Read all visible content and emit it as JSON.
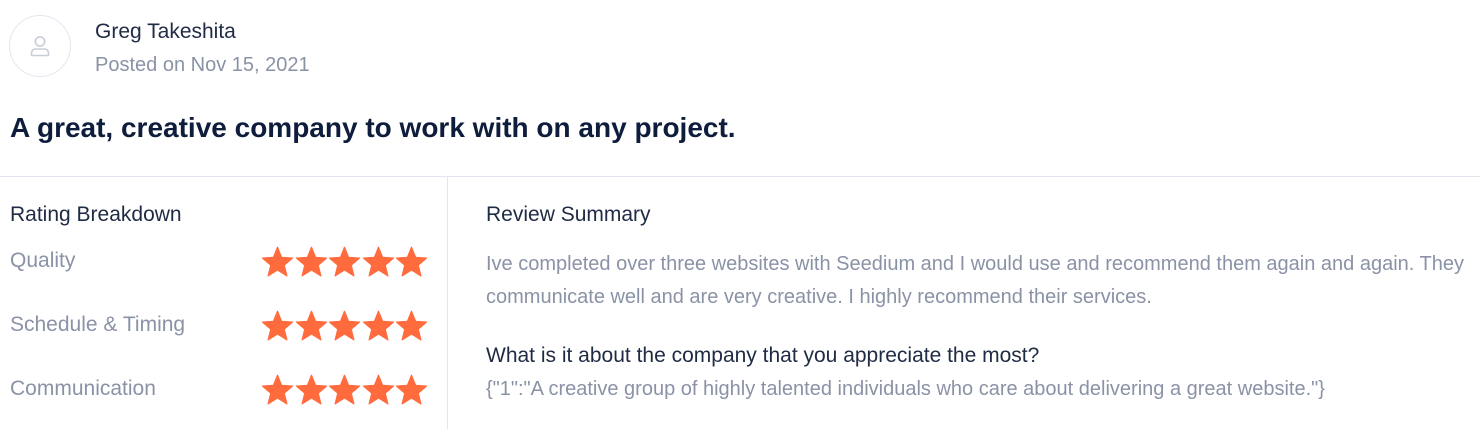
{
  "author": {
    "name": "Greg Takeshita",
    "posted": "Posted on Nov 15, 2021",
    "avatar_icon": "user-icon"
  },
  "headline": "A great, creative company to work with on any project.",
  "breakdown": {
    "title": "Rating Breakdown",
    "star_color": "#ff6b3d",
    "star_icon": "star-icon",
    "max_stars": 5,
    "items": [
      {
        "label": "Quality",
        "stars": 5
      },
      {
        "label": "Schedule & Timing",
        "stars": 5
      },
      {
        "label": "Communication",
        "stars": 5
      }
    ]
  },
  "summary": {
    "title": "Review Summary",
    "text": "Ive completed over three websites with Seedium and I would use and recommend them again and again. They communicate well and are very creative. I highly recommend their services.",
    "question": "What is it about the company that you appreciate the most?",
    "answer": "{\"1\":\"A creative group of highly talented individuals who care about delivering a great website.\"}"
  },
  "colors": {
    "heading": "#0f1d3d",
    "text": "#1f2a44",
    "muted": "#8a92a6",
    "border": "#e3e6ee"
  }
}
